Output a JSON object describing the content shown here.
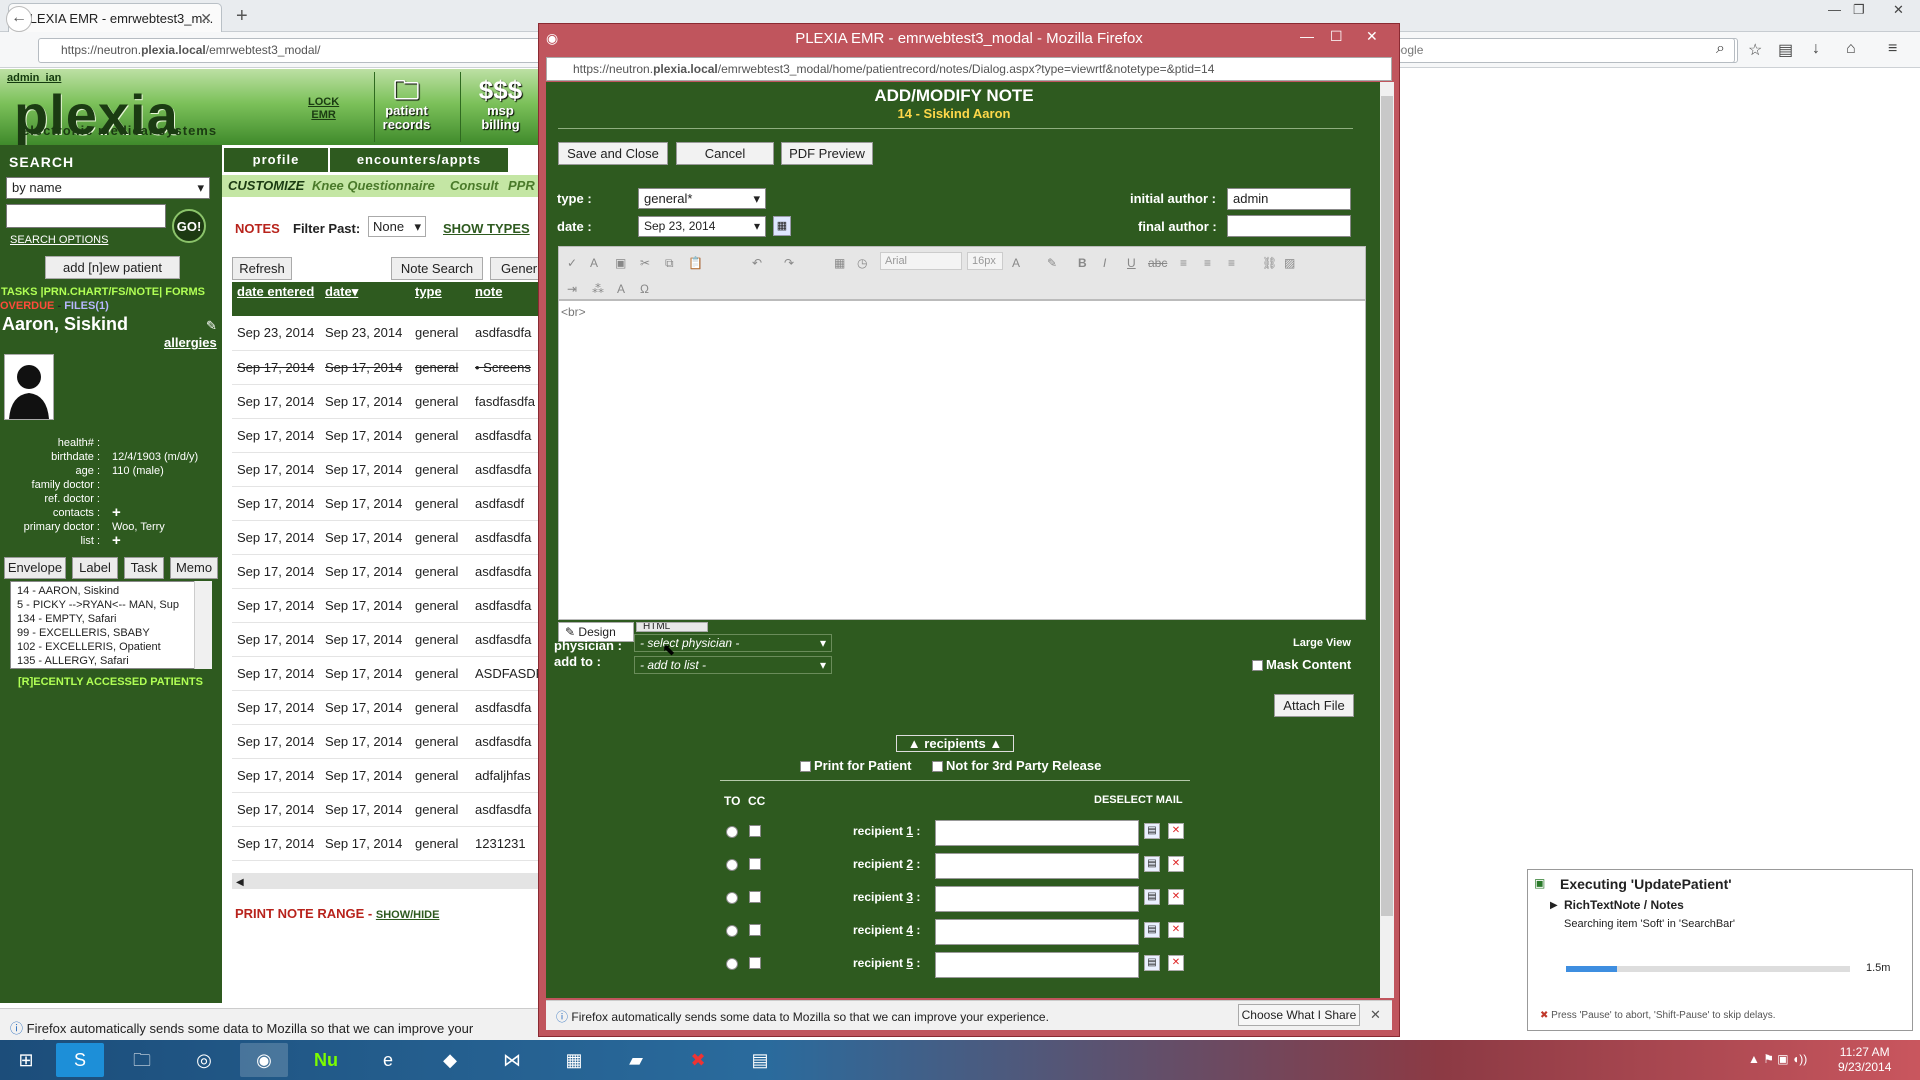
{
  "browser": {
    "tab_title": "PLEXIA EMR - emrwebtest3_m...",
    "url_prefix": "https://neutron.",
    "url_host": "plexia.local",
    "url_path": "/emrwebtest3_modal/",
    "search_placeholder": "oogle",
    "notification": "Firefox automatically sends some data to Mozilla so that we can improve your experience."
  },
  "app": {
    "admin_link": "admin_ian",
    "logo": "plexia",
    "logo_sub": "electronic medical systems",
    "lock_emr": "LOCK\nEMR",
    "tile_patient": "patient\nrecords",
    "tile_billing": "msp\nbilling",
    "tile_billing_sym": "$$$"
  },
  "sidebar": {
    "search_heading": "SEARCH",
    "search_by": "by name",
    "go_label": "GO!",
    "search_options": "SEARCH OPTIONS",
    "add_patient": "add [n]ew patient",
    "links": "TASKS |PRN.CHART/FS/NOTE| FORMS",
    "overdue": "OVERDUE",
    "files": "FILES(1)",
    "patient_name": "Aaron, Siskind",
    "allergies": "allergies",
    "fields": [
      {
        "label": "health# :",
        "value": ""
      },
      {
        "label": "birthdate :",
        "value": "12/4/1903 (m/d/y)"
      },
      {
        "label": "age :",
        "value": "110 (male)"
      },
      {
        "label": "family doctor :",
        "value": ""
      },
      {
        "label": "ref. doctor :",
        "value": ""
      },
      {
        "label": "contacts :",
        "value": "+"
      },
      {
        "label": "primary doctor :",
        "value": "Woo, Terry"
      },
      {
        "label": "list :",
        "value": "+"
      }
    ],
    "action_tabs": [
      "Envelope",
      "Label",
      "Task",
      "Memo"
    ],
    "recent_list": [
      "14 - AARON, Siskind",
      "5 - PICKY -->RYAN<-- MAN, Sup",
      "134 - EMPTY, Safari",
      "99 - EXCELLERIS, SBABY",
      "102 - EXCELLERIS, Opatient",
      "135 - ALLERGY, Safari"
    ],
    "recent_label": "[R]ECENTLY ACCESSED PATIENTS"
  },
  "main": {
    "tabs": [
      "profile",
      "encounters/appts"
    ],
    "subtabs": [
      "CUSTOMIZE",
      "Knee Questionnaire",
      "Consult",
      "PPR"
    ],
    "notes_label": "NOTES",
    "filter_label": "Filter Past:",
    "filter_value": "None",
    "show_types": "SHOW TYPES",
    "buttons": [
      "Refresh",
      "Note Search",
      "Gener"
    ],
    "columns": [
      "date entered",
      "date▾",
      "type",
      "note"
    ],
    "rows": [
      {
        "entered": "Sep 23, 2014",
        "date": "Sep 23, 2014",
        "type": "general",
        "note": "asdfasdfa"
      },
      {
        "entered": "Sep 17, 2014",
        "date": "Sep 17, 2014",
        "type": "general",
        "note": "• Screens"
      },
      {
        "entered": "Sep 17, 2014",
        "date": "Sep 17, 2014",
        "type": "general",
        "note": "fasdfasdfa"
      },
      {
        "entered": "Sep 17, 2014",
        "date": "Sep 17, 2014",
        "type": "general",
        "note": "asdfasdfa"
      },
      {
        "entered": "Sep 17, 2014",
        "date": "Sep 17, 2014",
        "type": "general",
        "note": "asdfasdfa"
      },
      {
        "entered": "Sep 17, 2014",
        "date": "Sep 17, 2014",
        "type": "general",
        "note": "asdfasdf"
      },
      {
        "entered": "Sep 17, 2014",
        "date": "Sep 17, 2014",
        "type": "general",
        "note": "asdfasdfa"
      },
      {
        "entered": "Sep 17, 2014",
        "date": "Sep 17, 2014",
        "type": "general",
        "note": "asdfasdfa"
      },
      {
        "entered": "Sep 17, 2014",
        "date": "Sep 17, 2014",
        "type": "general",
        "note": "asdfasdfa"
      },
      {
        "entered": "Sep 17, 2014",
        "date": "Sep 17, 2014",
        "type": "general",
        "note": "asdfasdfa"
      },
      {
        "entered": "Sep 17, 2014",
        "date": "Sep 17, 2014",
        "type": "general",
        "note": "ASDFASDF"
      },
      {
        "entered": "Sep 17, 2014",
        "date": "Sep 17, 2014",
        "type": "general",
        "note": "asdfasdfa"
      },
      {
        "entered": "Sep 17, 2014",
        "date": "Sep 17, 2014",
        "type": "general",
        "note": "asdfasdfa"
      },
      {
        "entered": "Sep 17, 2014",
        "date": "Sep 17, 2014",
        "type": "general",
        "note": "adfaljhfas"
      },
      {
        "entered": "Sep 17, 2014",
        "date": "Sep 17, 2014",
        "type": "general",
        "note": "asdfasdfa"
      },
      {
        "entered": "Sep 17, 2014",
        "date": "Sep 17, 2014",
        "type": "general",
        "note": "1231231"
      }
    ],
    "print_range": "PRINT NOTE RANGE -",
    "show_hide": "SHOW/HIDE"
  },
  "modal": {
    "window_title": "PLEXIA EMR - emrwebtest3_modal - Mozilla Firefox",
    "url_prefix": "https://neutron.",
    "url_host": "plexia.local",
    "url_path": "/emrwebtest3_modal/home/patientrecord/notes/Dialog.aspx?type=viewrtf&notetype=&ptid=14",
    "heading": "ADD/MODIFY NOTE",
    "subheading": "14 - Siskind Aaron",
    "buttons": {
      "save": "Save and Close",
      "cancel": "Cancel",
      "pdf": "PDF Preview"
    },
    "type_label": "type :",
    "type_value": "general*",
    "date_label": "date :",
    "date_value": "Sep 23, 2014",
    "initial_author_label": "initial author :",
    "initial_author_value": "admin",
    "final_author_label": "final author :",
    "final_author_value": "",
    "editor_font": "Arial",
    "editor_size": "16px",
    "editor_content": "<br>",
    "mode_design": "Design",
    "mode_html": "HTML",
    "physician_label": "physician :",
    "physician_placeholder": "- select physician -",
    "add_to_label": "add to :",
    "add_to_placeholder": "- add to list -",
    "large_view": "Large View",
    "mask_content": "Mask Content",
    "attach_file": "Attach File",
    "recipients_toggle": "recipients",
    "print_for_patient": "Print for Patient",
    "not_3rd_party": "Not for 3rd Party Release",
    "to_label": "TO",
    "cc_label": "CC",
    "deselect_mail": "DESELECT MAIL",
    "recipients": [
      {
        "label": "recipient",
        "num": "1"
      },
      {
        "label": "recipient",
        "num": "2"
      },
      {
        "label": "recipient",
        "num": "3"
      },
      {
        "label": "recipient",
        "num": "4"
      },
      {
        "label": "recipient",
        "num": "5"
      }
    ],
    "notification": "Firefox automatically sends some data to Mozilla so that we can improve your experience.",
    "choose_share": "Choose What I Share"
  },
  "exec_panel": {
    "title": "Executing 'UpdatePatient'",
    "step": "RichTextNote / Notes",
    "detail": "Searching item 'Soft' in 'SearchBar'",
    "progress_fraction": 0.18,
    "time": "1.5m",
    "hint": "Press 'Pause' to abort, 'Shift-Pause' to skip delays."
  },
  "taskbar": {
    "time": "11:27 AM",
    "date": "9/23/2014"
  },
  "colors": {
    "app_green": "#2e5a1f",
    "modal_frame": "#c0555d",
    "accent_red": "#b8231c",
    "link_lime": "#b0ff55"
  }
}
